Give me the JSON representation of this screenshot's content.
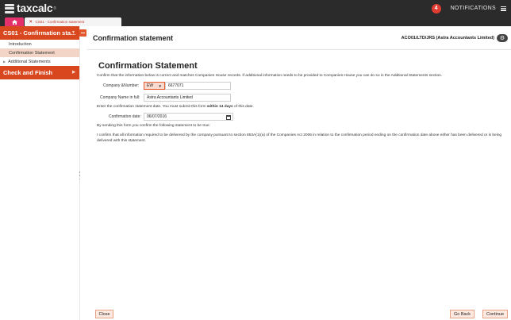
{
  "app": {
    "logo_text": "taxcalc",
    "logo_reg": "®",
    "notifications_count": "4",
    "notifications_label": "NOTIFICATIONS"
  },
  "tabs": {
    "home_icon": "home-icon",
    "document_tab_label": "CS01 - Confirmation statement"
  },
  "sidebar": {
    "section_main": "CS01 - Confirmation sta...",
    "items": [
      {
        "label": "Introduction"
      },
      {
        "label": "Confirmation Statement"
      },
      {
        "label": "Additional Statements"
      }
    ],
    "section_check": "Check and Finish"
  },
  "header": {
    "title": "Confirmation statement",
    "client_ref": "ACO01/LTD/JRS (Astra Accountants Limited)"
  },
  "form": {
    "title": "Confirmation Statement",
    "intro": "Confirm that the information below is correct and matches Companies House records. If additional information needs to be provided to Companies House you can do so in the Additional Statements section.",
    "company_number_label": "Company &Number:",
    "company_prefix": "EW",
    "company_number": "6677071",
    "company_name_label": "Company Name in full:",
    "company_name": "Astra Accountants Limited",
    "date_instruction_pre": "Enter the confirmation statement date. You must submit this form ",
    "date_instruction_bold": "within 14 days",
    "date_instruction_post": " of this date.",
    "date_label": "Confirmation date:",
    "date_value": "06/07/2016",
    "confirm_text": "By sending this form you confirm the following statement to be true:",
    "statement": "I confirm that all information required to be delivered by the company pursuant to section 853A(1)(a) of the Companies Act 2006 in relation to the confirmation period ending on the confirmation date above either has been delivered or is being delivered with this statement."
  },
  "footer": {
    "close_label": "Close",
    "back_label": "Go Back",
    "continue_label": "Continue"
  },
  "colors": {
    "accent": "#d9471f",
    "tab_home": "#e5316b",
    "topbar": "#2b2b2b",
    "sidebar_active": "#f2d5c6"
  }
}
